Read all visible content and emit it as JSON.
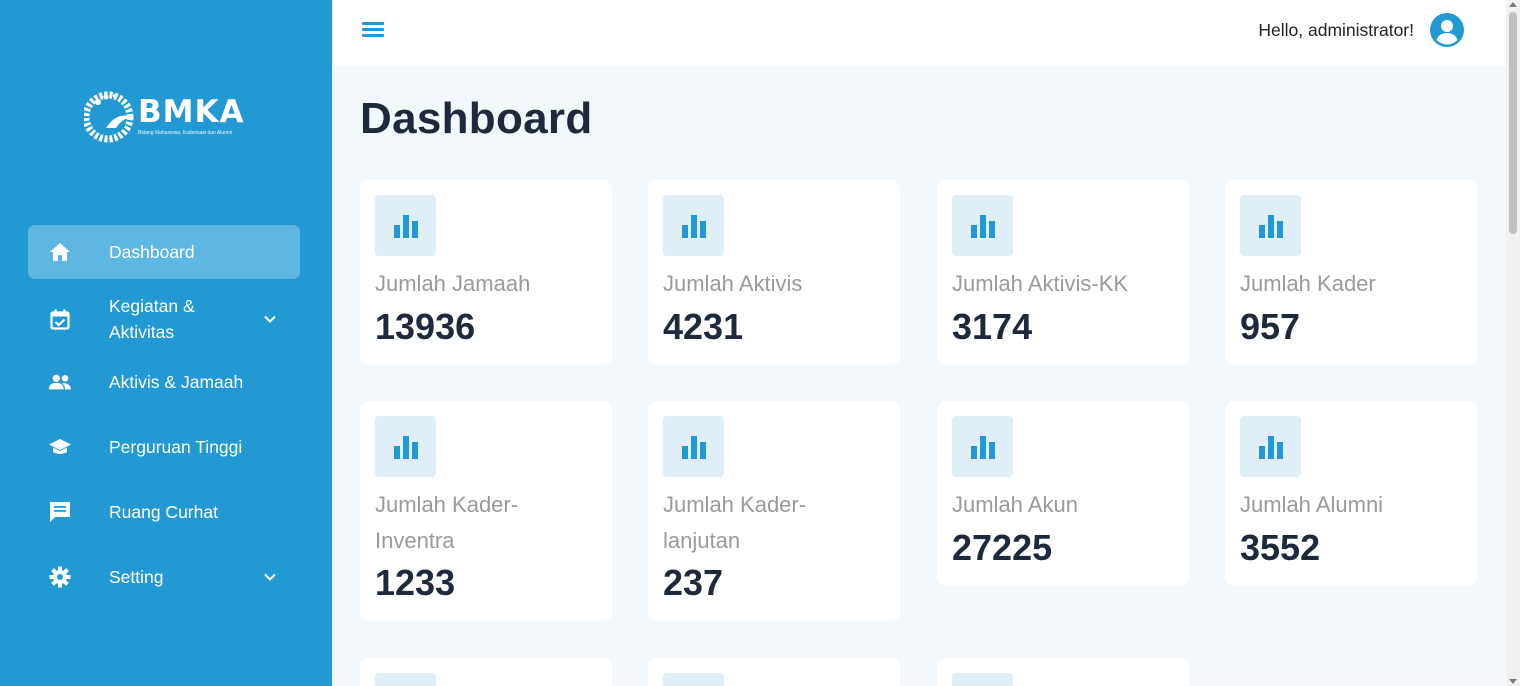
{
  "brand": {
    "name": "BMKA",
    "tagline": "Bidang Mahasiswa, Kaderisasi dan Alumni"
  },
  "colors": {
    "sidebar": "#2399d3",
    "sidebar_active": "#5db7e2",
    "accent": "#2399d3",
    "card_icon_bg": "#e0eef7"
  },
  "sidebar": {
    "items": [
      {
        "label": "Dashboard",
        "icon": "home-icon",
        "active": true
      },
      {
        "label": "Kegiatan & Aktivitas",
        "icon": "calendar-check-icon",
        "expandable": true
      },
      {
        "label": "Aktivis & Jamaah",
        "icon": "people-icon"
      },
      {
        "label": "Perguruan Tinggi",
        "icon": "graduation-cap-icon"
      },
      {
        "label": "Ruang Curhat",
        "icon": "chat-icon"
      },
      {
        "label": "Setting",
        "icon": "gear-icon",
        "expandable": true
      }
    ]
  },
  "header": {
    "menu_icon": "hamburger-icon",
    "greeting": "Hello, administrator!",
    "avatar_icon": "user-circle-icon"
  },
  "main": {
    "title": "Dashboard",
    "cards": [
      {
        "label": "Jumlah Jamaah",
        "value": "13936",
        "icon": "bar-chart-icon"
      },
      {
        "label": "Jumlah Aktivis",
        "value": "4231",
        "icon": "bar-chart-icon"
      },
      {
        "label": "Jumlah Aktivis-KK",
        "value": "3174",
        "icon": "bar-chart-icon"
      },
      {
        "label": "Jumlah Kader",
        "value": "957",
        "icon": "bar-chart-icon"
      },
      {
        "label": "Jumlah Kader-Inventra",
        "value": "1233",
        "icon": "bar-chart-icon"
      },
      {
        "label": "Jumlah Kader-lanjutan",
        "value": "237",
        "icon": "bar-chart-icon"
      },
      {
        "label": "Jumlah Akun",
        "value": "27225",
        "icon": "bar-chart-icon"
      },
      {
        "label": "Jumlah Alumni",
        "value": "3552",
        "icon": "bar-chart-icon"
      }
    ]
  }
}
